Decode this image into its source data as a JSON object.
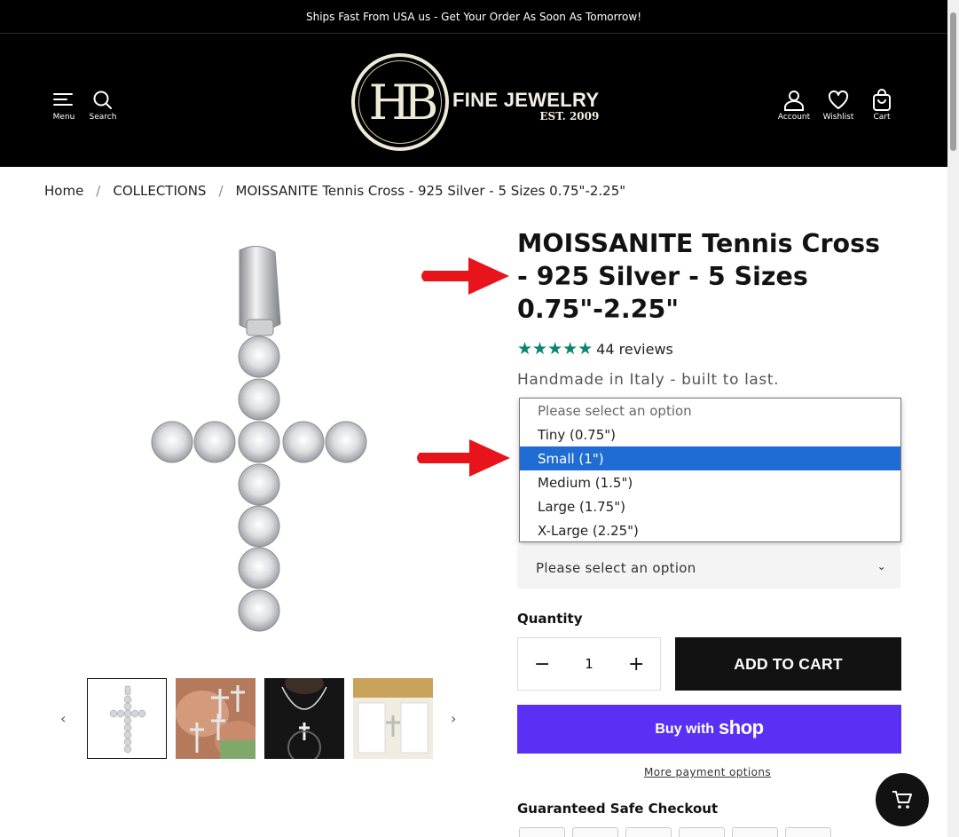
{
  "announcement": "Ships Fast From USA us - Get Your Order As Soon As Tomorrow!",
  "header": {
    "menu_label": "Menu",
    "search_label": "Search",
    "account_label": "Account",
    "wishlist_label": "Wishlist",
    "cart_label": "Cart",
    "logo_line1": "FINE JEWELRY",
    "logo_line2": "EST. 2009",
    "logo_monogram": "HB"
  },
  "breadcrumb": [
    "Home",
    "COLLECTIONS",
    "MOISSANITE Tennis Cross - 925 Silver - 5 Sizes 0.75\"-2.25\""
  ],
  "product": {
    "title": "MOISSANITE Tennis Cross - 925 Silver - 5 Sizes 0.75\"-2.25\"",
    "rating": 5,
    "reviews": "44 reviews",
    "tagline": "Handmade in Italy - built to last.",
    "size_dropdown": {
      "options": [
        "Please select an option",
        "Tiny (0.75\")",
        "Small (1\")",
        "Medium (1.5\")",
        "Large (1.75\")",
        "X-Large (2.25\")"
      ],
      "highlighted": "Small (1\")"
    },
    "second_select_value": "Please select an option",
    "quantity_label": "Quantity",
    "quantity_value": "1",
    "add_to_cart": "ADD TO CART",
    "buy_with": "Buy with",
    "shop_brand": "shop",
    "more_payment": "More payment options",
    "guaranteed": "Guaranteed Safe Checkout"
  },
  "colors": {
    "accent_purple": "#5a31f4",
    "star_green": "#0a8571",
    "highlight_blue": "#1f6cd4",
    "annotation_red": "#e8141b"
  }
}
